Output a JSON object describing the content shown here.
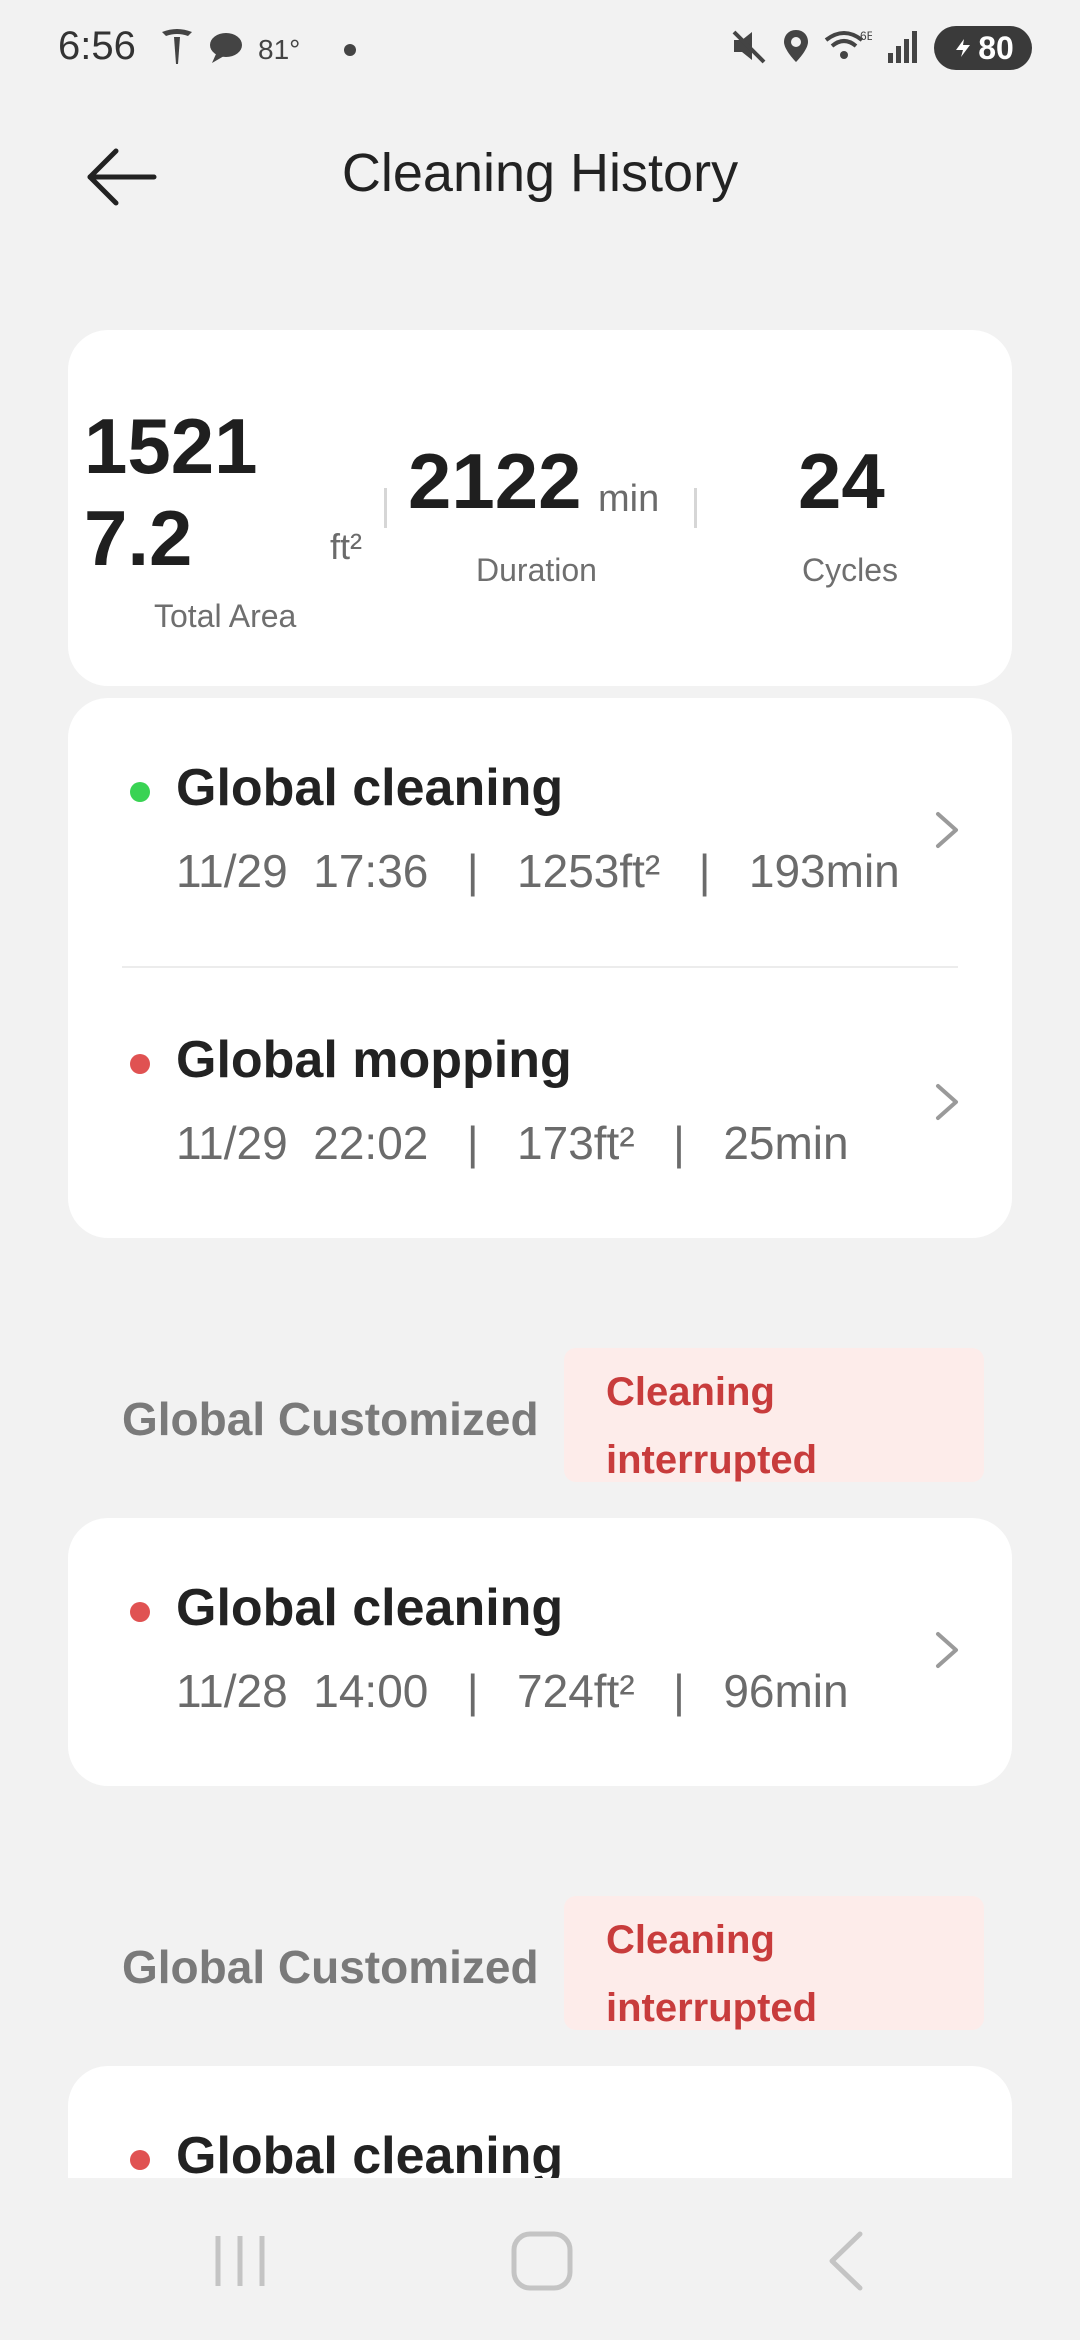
{
  "status_bar": {
    "time": "6:56",
    "temperature": "81°",
    "battery": "80",
    "icons": [
      "tesla-icon",
      "chat-icon",
      "mute-icon",
      "location-icon",
      "wifi-6e-icon",
      "signal-icon"
    ]
  },
  "header": {
    "title": "Cleaning History",
    "back_icon": "arrow-left-icon"
  },
  "summary": {
    "total_area": "15217.2",
    "total_area_unit": "ft²",
    "total_area_label": "Total Area",
    "duration": "2122",
    "duration_unit": "min",
    "duration_label": "Duration",
    "cycles": "24",
    "cycles_label": "Cycles"
  },
  "groups": [
    {
      "records": [
        {
          "title": "Global cleaning",
          "date": "11/29",
          "time": "17:36",
          "area": "1253ft²",
          "duration": "193min",
          "status_color": "#39d353"
        },
        {
          "title": "Global mopping",
          "date": "11/29",
          "time": "22:02",
          "area": "173ft²",
          "duration": "25min",
          "status_color": "#e05252"
        }
      ]
    },
    {
      "header": "Global Customized",
      "badge": "Cleaning interrupted",
      "records": [
        {
          "title": "Global cleaning",
          "date": "11/28",
          "time": "14:00",
          "area": "724ft²",
          "duration": "96min",
          "status_color": "#e05252"
        }
      ]
    },
    {
      "header": "Global Customized",
      "badge": "Cleaning interrupted",
      "records": [
        {
          "title": "Global cleaning",
          "status_color": "#e05252"
        }
      ]
    }
  ],
  "colors": {
    "background": "#f2f2f2",
    "card": "#ffffff",
    "badge_bg": "#fdecea",
    "badge_text": "#c83c3c"
  },
  "nav_bar": [
    "recents-icon",
    "home-icon",
    "back-icon"
  ]
}
